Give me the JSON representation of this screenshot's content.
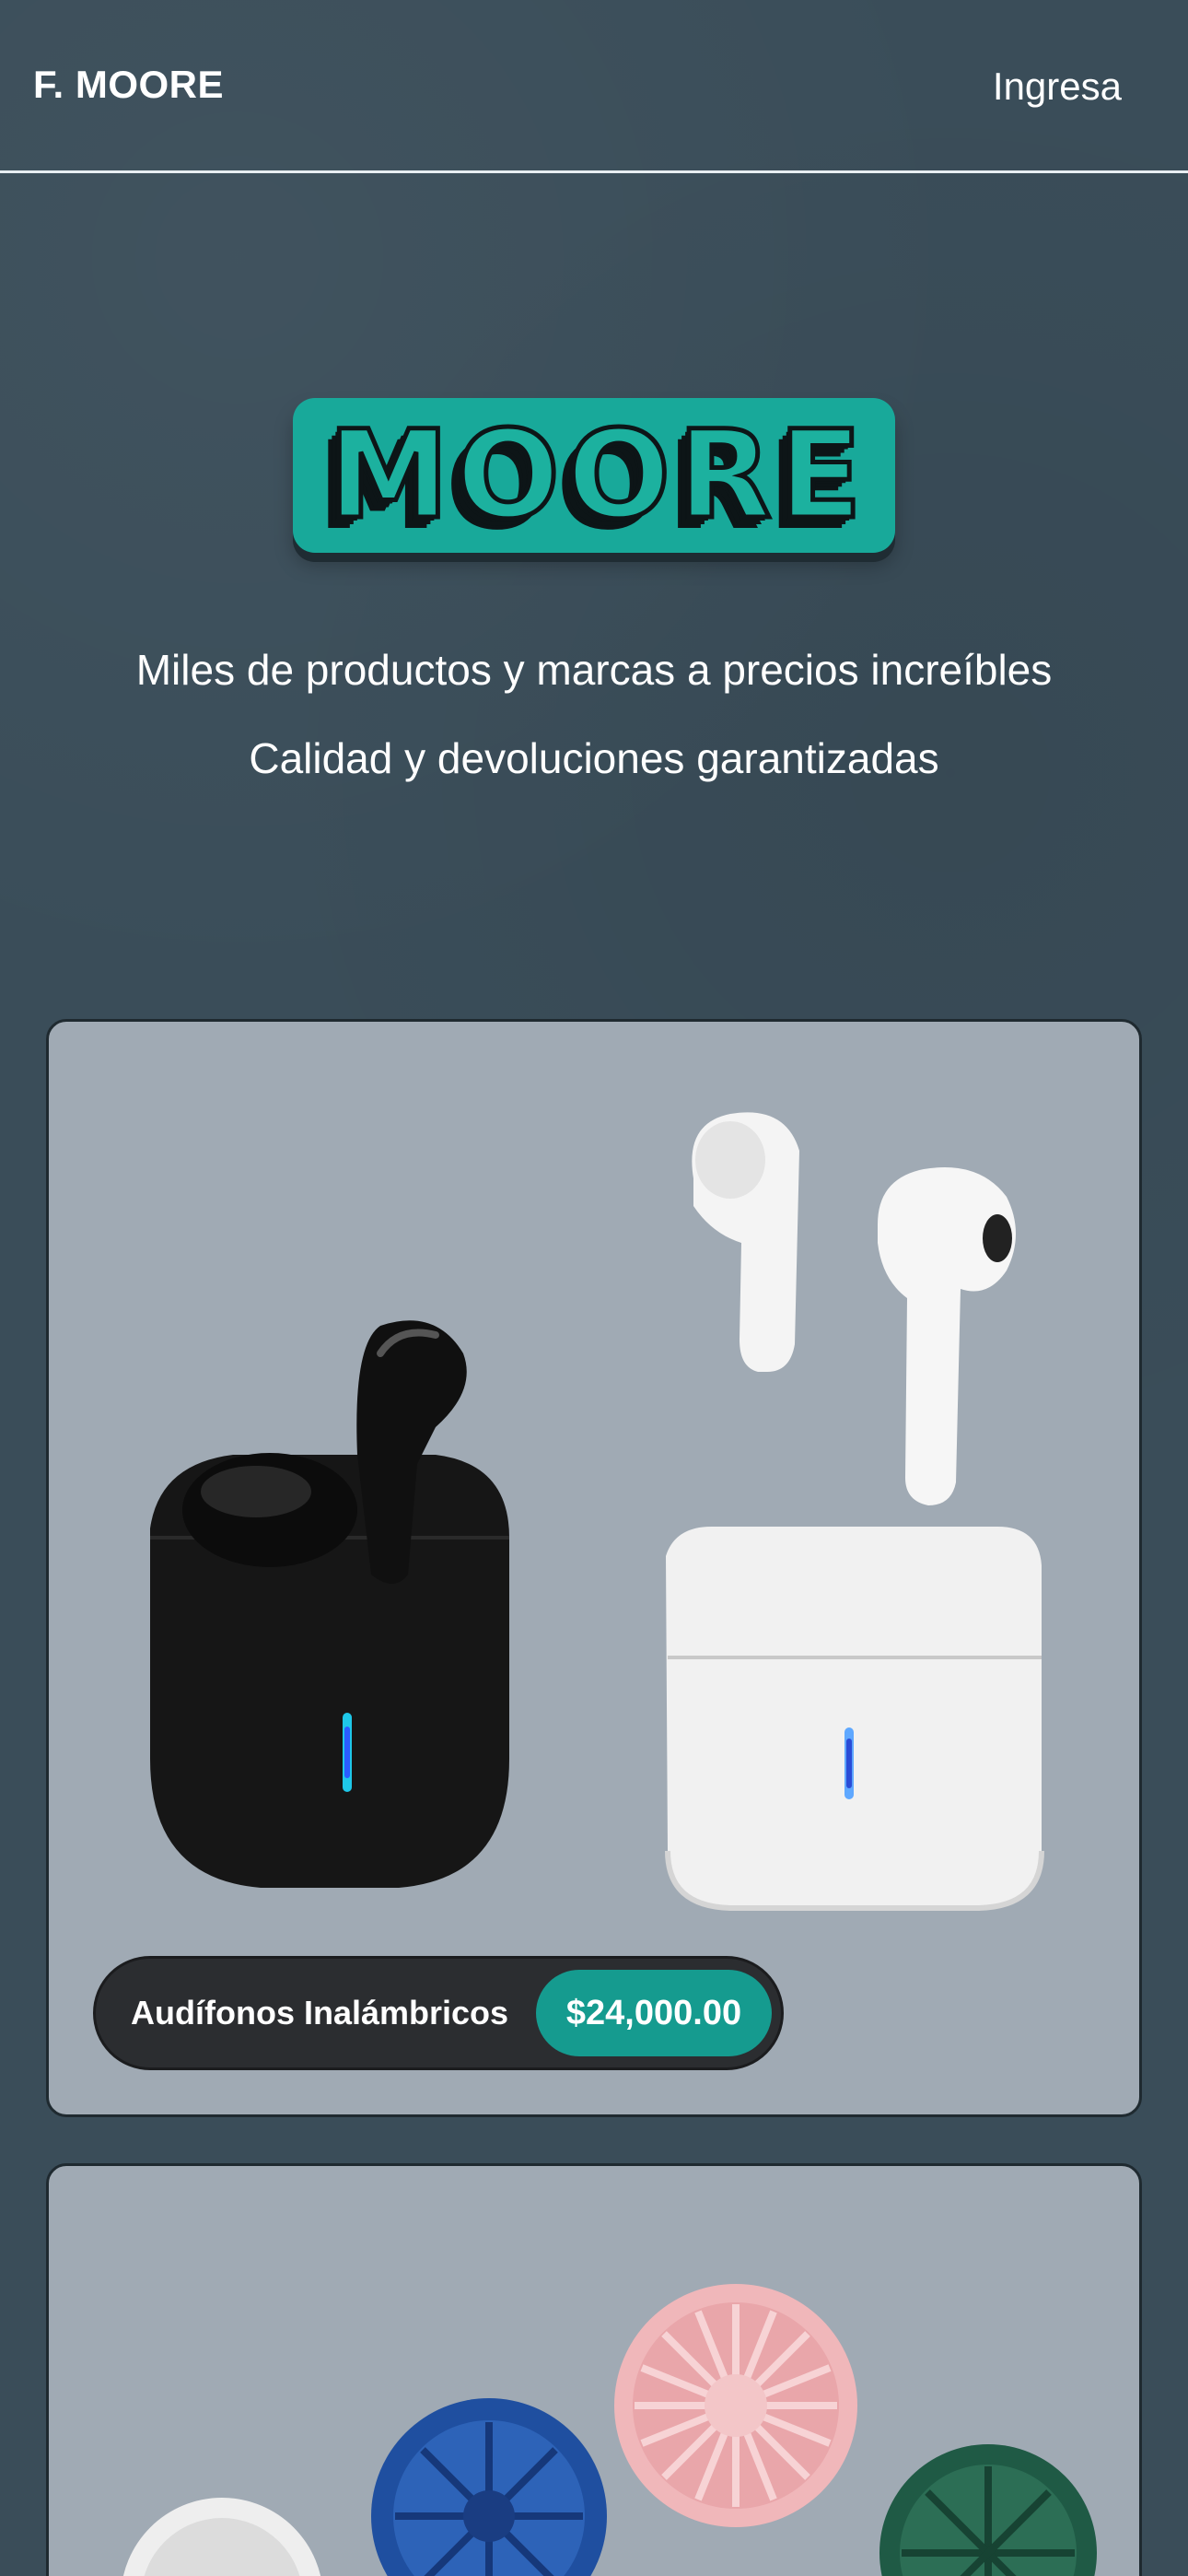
{
  "header": {
    "brand": "F. MOORE",
    "login_label": "Ingresa"
  },
  "hero": {
    "logo_text": "MOORE",
    "tagline_1": "Miles de productos y marcas a precios increíbles",
    "tagline_2": "Calidad y devoluciones garantizadas"
  },
  "products": [
    {
      "name": "Audífonos Inalámbricos",
      "price": "$24,000.00",
      "image_icon": "wireless-earbuds-image"
    },
    {
      "image_icon": "portable-fans-image"
    }
  ],
  "colors": {
    "background": "#3a4d59",
    "accent": "#18a99a",
    "card": "#a0aab4",
    "pill": "#2b2d30",
    "price_pill": "#159b8f"
  }
}
